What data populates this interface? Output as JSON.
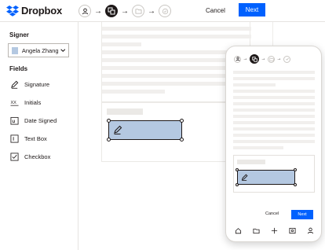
{
  "app": {
    "brand": "Dropbox",
    "brand_color": "#0061fe"
  },
  "header": {
    "steps": [
      "person-icon",
      "fields-icon",
      "folder-icon",
      "check-icon"
    ],
    "active_step": 1,
    "cancel_label": "Cancel",
    "next_label": "Next"
  },
  "sidebar": {
    "signer_heading": "Signer",
    "signer_value": "Angela Zhang",
    "signer_color": "#b4c8e1",
    "fields_heading": "Fields",
    "fields": [
      {
        "label": "Signature",
        "icon": "pen-icon"
      },
      {
        "label": "Initials",
        "icon": "initials-icon"
      },
      {
        "label": "Date Signed",
        "icon": "calendar-icon"
      },
      {
        "label": "Text Box",
        "icon": "text-box-icon"
      },
      {
        "label": "Checkbox",
        "icon": "checkbox-icon"
      }
    ]
  },
  "mobile": {
    "cancel_label": "Cancel",
    "next_label": "Next",
    "tabs": [
      "home-icon",
      "folder-icon",
      "plus-icon",
      "photo-icon",
      "account-icon"
    ]
  },
  "colors": {
    "accent": "#0061fe",
    "field_fill": "#b4c8e1",
    "text": "#1e1919"
  }
}
